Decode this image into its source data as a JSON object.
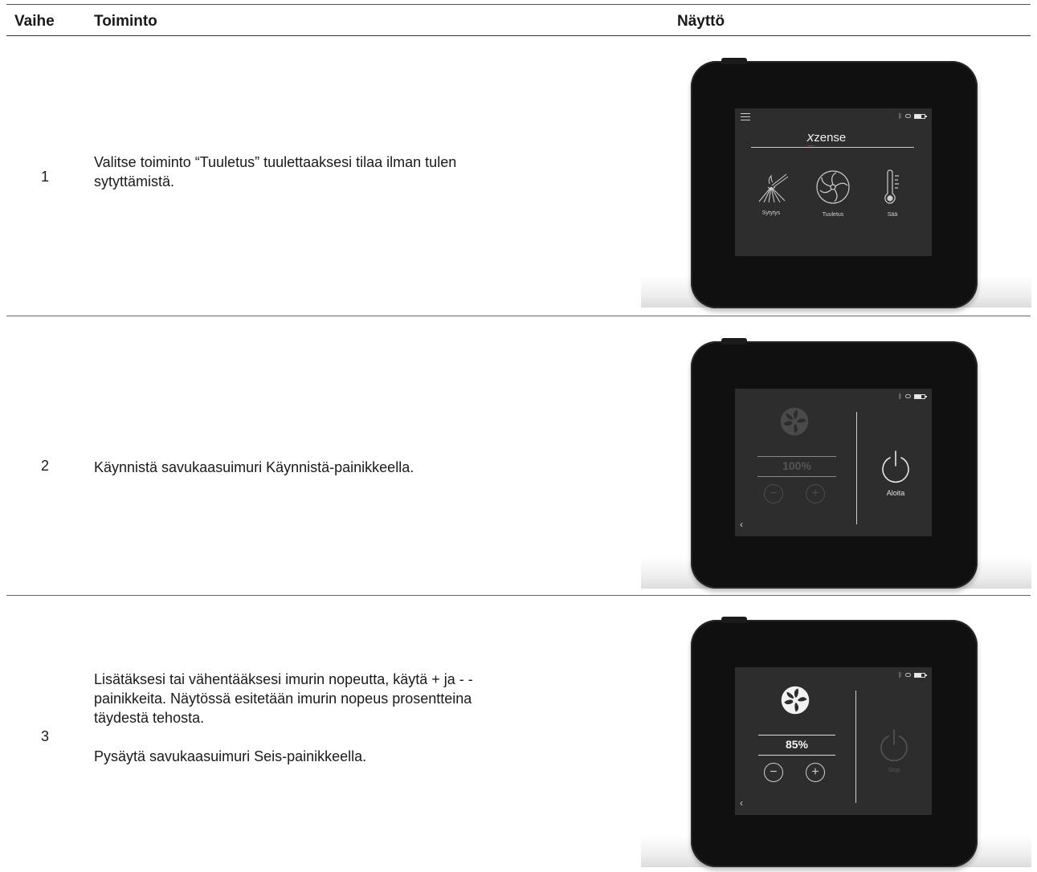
{
  "table": {
    "headers": {
      "step": "Vaihe",
      "action": "Toiminto",
      "display": "Näyttö"
    },
    "rows": [
      {
        "step": "1",
        "paragraphs": [
          "Valitse toiminto “Tuuletus” tuulettaaksesi tilaa ilman tulen sytyttämistä."
        ],
        "screen": {
          "logo": "zense",
          "logo_prefix": "x",
          "tiles": [
            "Sytytys",
            "Tuuletus",
            "Sää"
          ]
        }
      },
      {
        "step": "2",
        "paragraphs": [
          "Käynnistä savukaasuimuri Käynnistä-painikkeella."
        ],
        "screen": {
          "percent": "100%",
          "power_label": "Aloita",
          "minus": "−",
          "plus": "+",
          "back": "‹"
        }
      },
      {
        "step": "3",
        "paragraphs": [
          "Lisätäksesi tai vähentääksesi imurin nopeutta, käytä + ja - -painikkeita. Näytössä esitetään imurin nopeus prosentteina täydestä tehosta.",
          "Pysäytä savukaasuimuri Seis-painikkeella."
        ],
        "screen": {
          "percent": "85%",
          "power_label": "Stop",
          "minus": "−",
          "plus": "+",
          "back": "‹"
        }
      }
    ]
  },
  "colors": {
    "device": "#101010",
    "screen": "#2d2d2d",
    "brand_accent": "#c41e3a"
  },
  "icons": [
    "menu-icon",
    "bluetooth-icon",
    "signal-icon",
    "battery-icon",
    "kindling-icon",
    "fan-icon",
    "thermometer-icon",
    "power-icon",
    "minus-icon",
    "plus-icon",
    "back-chevron-icon"
  ]
}
